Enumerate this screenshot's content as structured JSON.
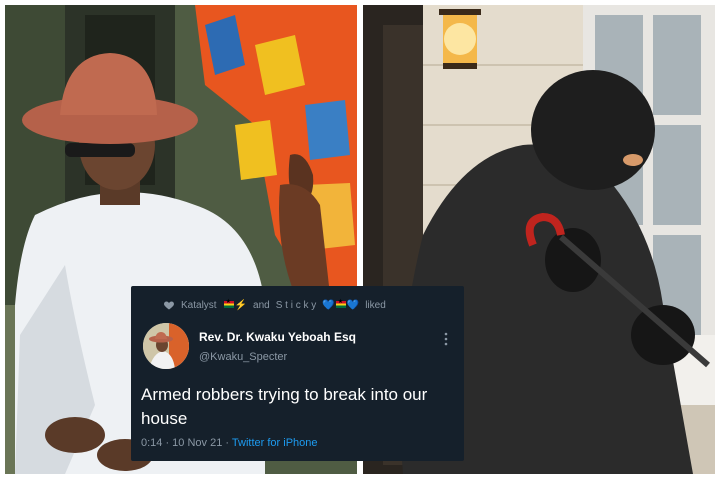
{
  "tweet": {
    "liked_prefix": "Katalyst",
    "liked_and": "and",
    "liked_user2": "S t i c k y",
    "liked_suffix": "liked",
    "display_name": "Rev. Dr. Kwaku Yeboah Esq",
    "handle": "@Kwaku_Specter",
    "text": "Armed robbers trying to break into our house",
    "time": "0:14 · 10 Nov 21 · ",
    "source": "Twitter for iPhone"
  },
  "colors": {
    "card_bg": "#15202b",
    "muted_text": "#8b98a5",
    "link_blue": "#1d9bf0"
  },
  "icons": [
    "heart-icon",
    "more-icon"
  ]
}
